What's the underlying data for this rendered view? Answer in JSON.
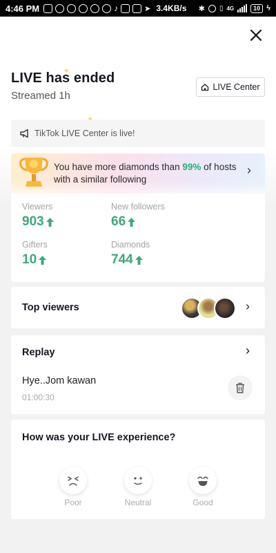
{
  "status_bar": {
    "time": "4:46 PM",
    "speed": "3.4KB/s",
    "network": "4G",
    "battery": "10"
  },
  "header": {
    "title": "LIVE has ended",
    "subtitle": "Streamed 1h",
    "live_center_label": "LIVE Center"
  },
  "announcement": {
    "text": "TikTok LIVE Center is live!"
  },
  "banner": {
    "text_before": "You have more diamonds than ",
    "percent": "99%",
    "text_after": " of hosts with a similar following"
  },
  "stats": [
    {
      "label": "Viewers",
      "value": "903"
    },
    {
      "label": "New followers",
      "value": "66"
    },
    {
      "label": "Gifters",
      "value": "10"
    },
    {
      "label": "Diamonds",
      "value": "744"
    }
  ],
  "top_viewers": {
    "title": "Top viewers"
  },
  "replay": {
    "title": "Replay",
    "name": "Hye..Jom kawan",
    "duration": "01:00:30"
  },
  "feedback": {
    "question": "How was your LIVE experience?",
    "options": [
      "Poor",
      "Neutral",
      "Good"
    ]
  },
  "colors": {
    "accent_green": "#3da87c",
    "percent_green": "#25b07a",
    "background": "#f2f2f2"
  }
}
